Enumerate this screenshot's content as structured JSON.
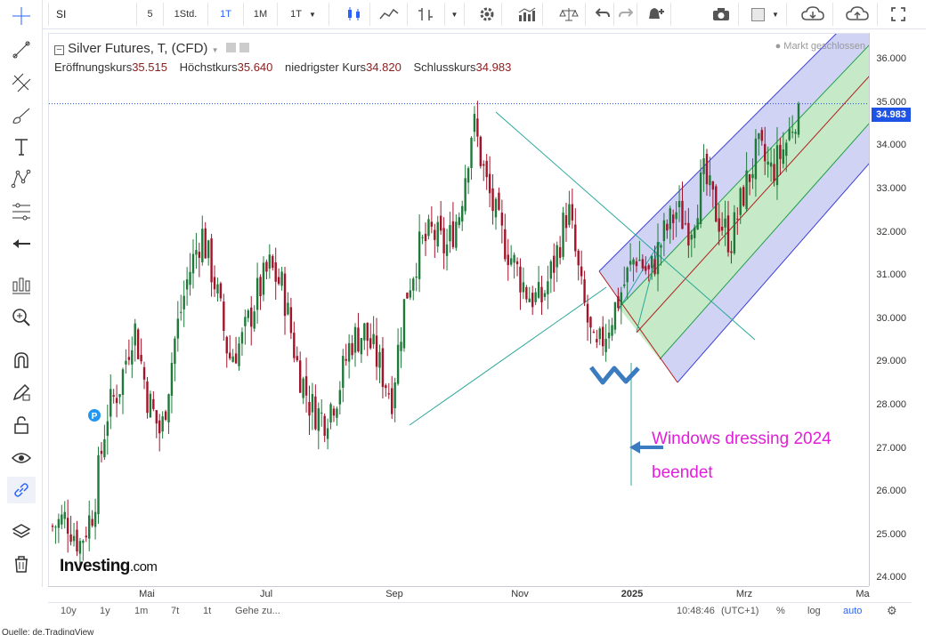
{
  "toolbar": {
    "symbol": "SI",
    "interval_5": "5",
    "interval_1h": "1Std.",
    "interval_1d": "1T",
    "interval_1m": "1M",
    "interval_dd": "1T"
  },
  "legend": {
    "title": "Silver Futures, T, (CFD)",
    "open_label": "Eröffnungskurs",
    "open_value": "35.515",
    "high_label": "Höchstkurs",
    "high_value": "35.640",
    "low_label": "niedrigster Kurs",
    "low_value": "34.820",
    "close_label": "Schlusskurs",
    "close_value": "34.983",
    "market_status": "Markt geschlossen"
  },
  "logo": {
    "brand": "Investing",
    "suffix": ".com"
  },
  "annotation": {
    "line1": "Windows dressing 2024",
    "line2": "beendet"
  },
  "price_axis": {
    "ticks": [
      "36.000",
      "35.000",
      "34.000",
      "33.000",
      "32.000",
      "31.000",
      "30.000",
      "29.000",
      "28.000",
      "27.000",
      "26.000",
      "25.000",
      "24.000"
    ],
    "current_price": "34.983"
  },
  "time_axis": {
    "ticks": [
      "Mai",
      "Jul",
      "Sep",
      "Nov",
      "2025",
      "Mrz",
      "Ma"
    ]
  },
  "bottom_bar": {
    "ranges": [
      "10y",
      "1y",
      "1m",
      "7t",
      "1t"
    ],
    "goto": "Gehe zu...",
    "time": "10:48:46",
    "timezone": "(UTC+1)",
    "percent": "%",
    "log": "log",
    "auto": "auto"
  },
  "footnote": "Quelle: de.TradingView",
  "colors": {
    "up": "#1f7a3a",
    "down": "#a3142a",
    "channel_blue": "#3b3fd8",
    "channel_green": "#22a04a",
    "annotation": "#e020d8",
    "price_label": "#1e53e5"
  },
  "chart_data": {
    "type": "candlestick",
    "title": "Silver Futures, T, (CFD)",
    "x_ticks": [
      "Mai",
      "Jul",
      "Sep",
      "Nov",
      "2025",
      "Mrz",
      "Ma"
    ],
    "ylim": [
      23.8,
      36.6
    ],
    "y_ticks": [
      24,
      25,
      26,
      27,
      28,
      29,
      30,
      31,
      32,
      33,
      34,
      35,
      36
    ],
    "last_close": 34.983,
    "close_path": [
      25.2,
      25.4,
      24.8,
      25.6,
      27.8,
      28.5,
      29.9,
      28.2,
      27.3,
      29.5,
      31.0,
      32.0,
      30.8,
      29.1,
      29.5,
      30.5,
      31.2,
      30.7,
      29.0,
      28.0,
      27.7,
      28.3,
      29.5,
      29.7,
      29.0,
      28.2,
      30.5,
      31.6,
      32.0,
      31.6,
      32.5,
      34.6,
      33.1,
      32.0,
      31.3,
      30.6,
      30.4,
      31.3,
      32.6,
      30.6,
      29.1,
      29.9,
      30.7,
      31.5,
      31.0,
      31.9,
      32.5,
      32.1,
      33.3,
      32.4,
      31.8,
      33.0,
      33.9,
      33.4,
      34.0,
      34.983
    ]
  }
}
